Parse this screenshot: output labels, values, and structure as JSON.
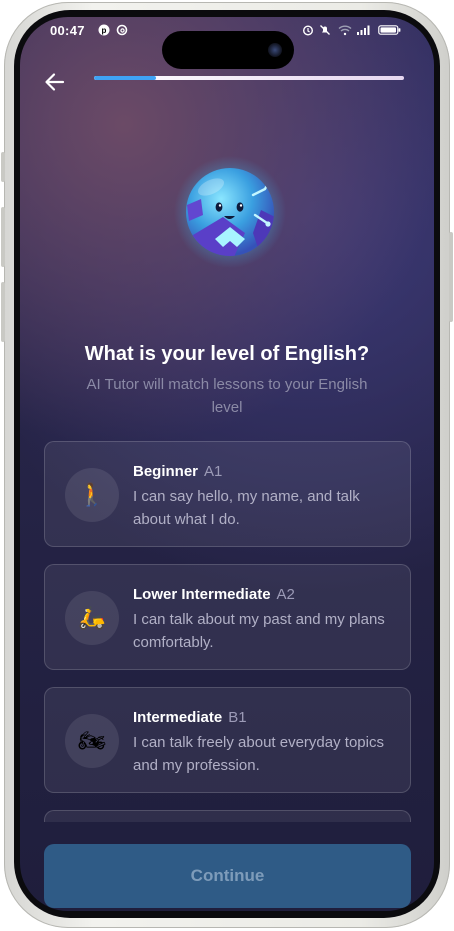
{
  "status_bar": {
    "time": "00:47",
    "left_icons": [
      "pinterest-icon",
      "threads-icon"
    ],
    "right_icons": [
      "alarm-icon",
      "mute-icon",
      "wifi-icon",
      "signal-icon",
      "battery-icon"
    ]
  },
  "header": {
    "back_icon": "arrow-left-icon",
    "progress_fraction": 0.2,
    "progress_color": "#3fa3f5"
  },
  "question": {
    "title": "What is your level of English?",
    "subtitle": "AI Tutor will match lessons to your English level"
  },
  "levels": [
    {
      "icon": "walking-person-icon",
      "glyph": "🚶",
      "name": "Beginner",
      "level": "A1",
      "description": "I can say hello, my name, and talk about what I do."
    },
    {
      "icon": "scooter-icon",
      "glyph": "🛵",
      "name": "Lower Intermediate",
      "level": "A2",
      "description": "I can talk about my past and my plans comfortably."
    },
    {
      "icon": "motorcycle-icon",
      "glyph": "🏍",
      "name": "Intermediate",
      "level": "B1",
      "description": "I can talk freely about everyday topics and my profession."
    }
  ],
  "footer": {
    "continue_label": "Continue",
    "button_color": "#2f5b86"
  }
}
